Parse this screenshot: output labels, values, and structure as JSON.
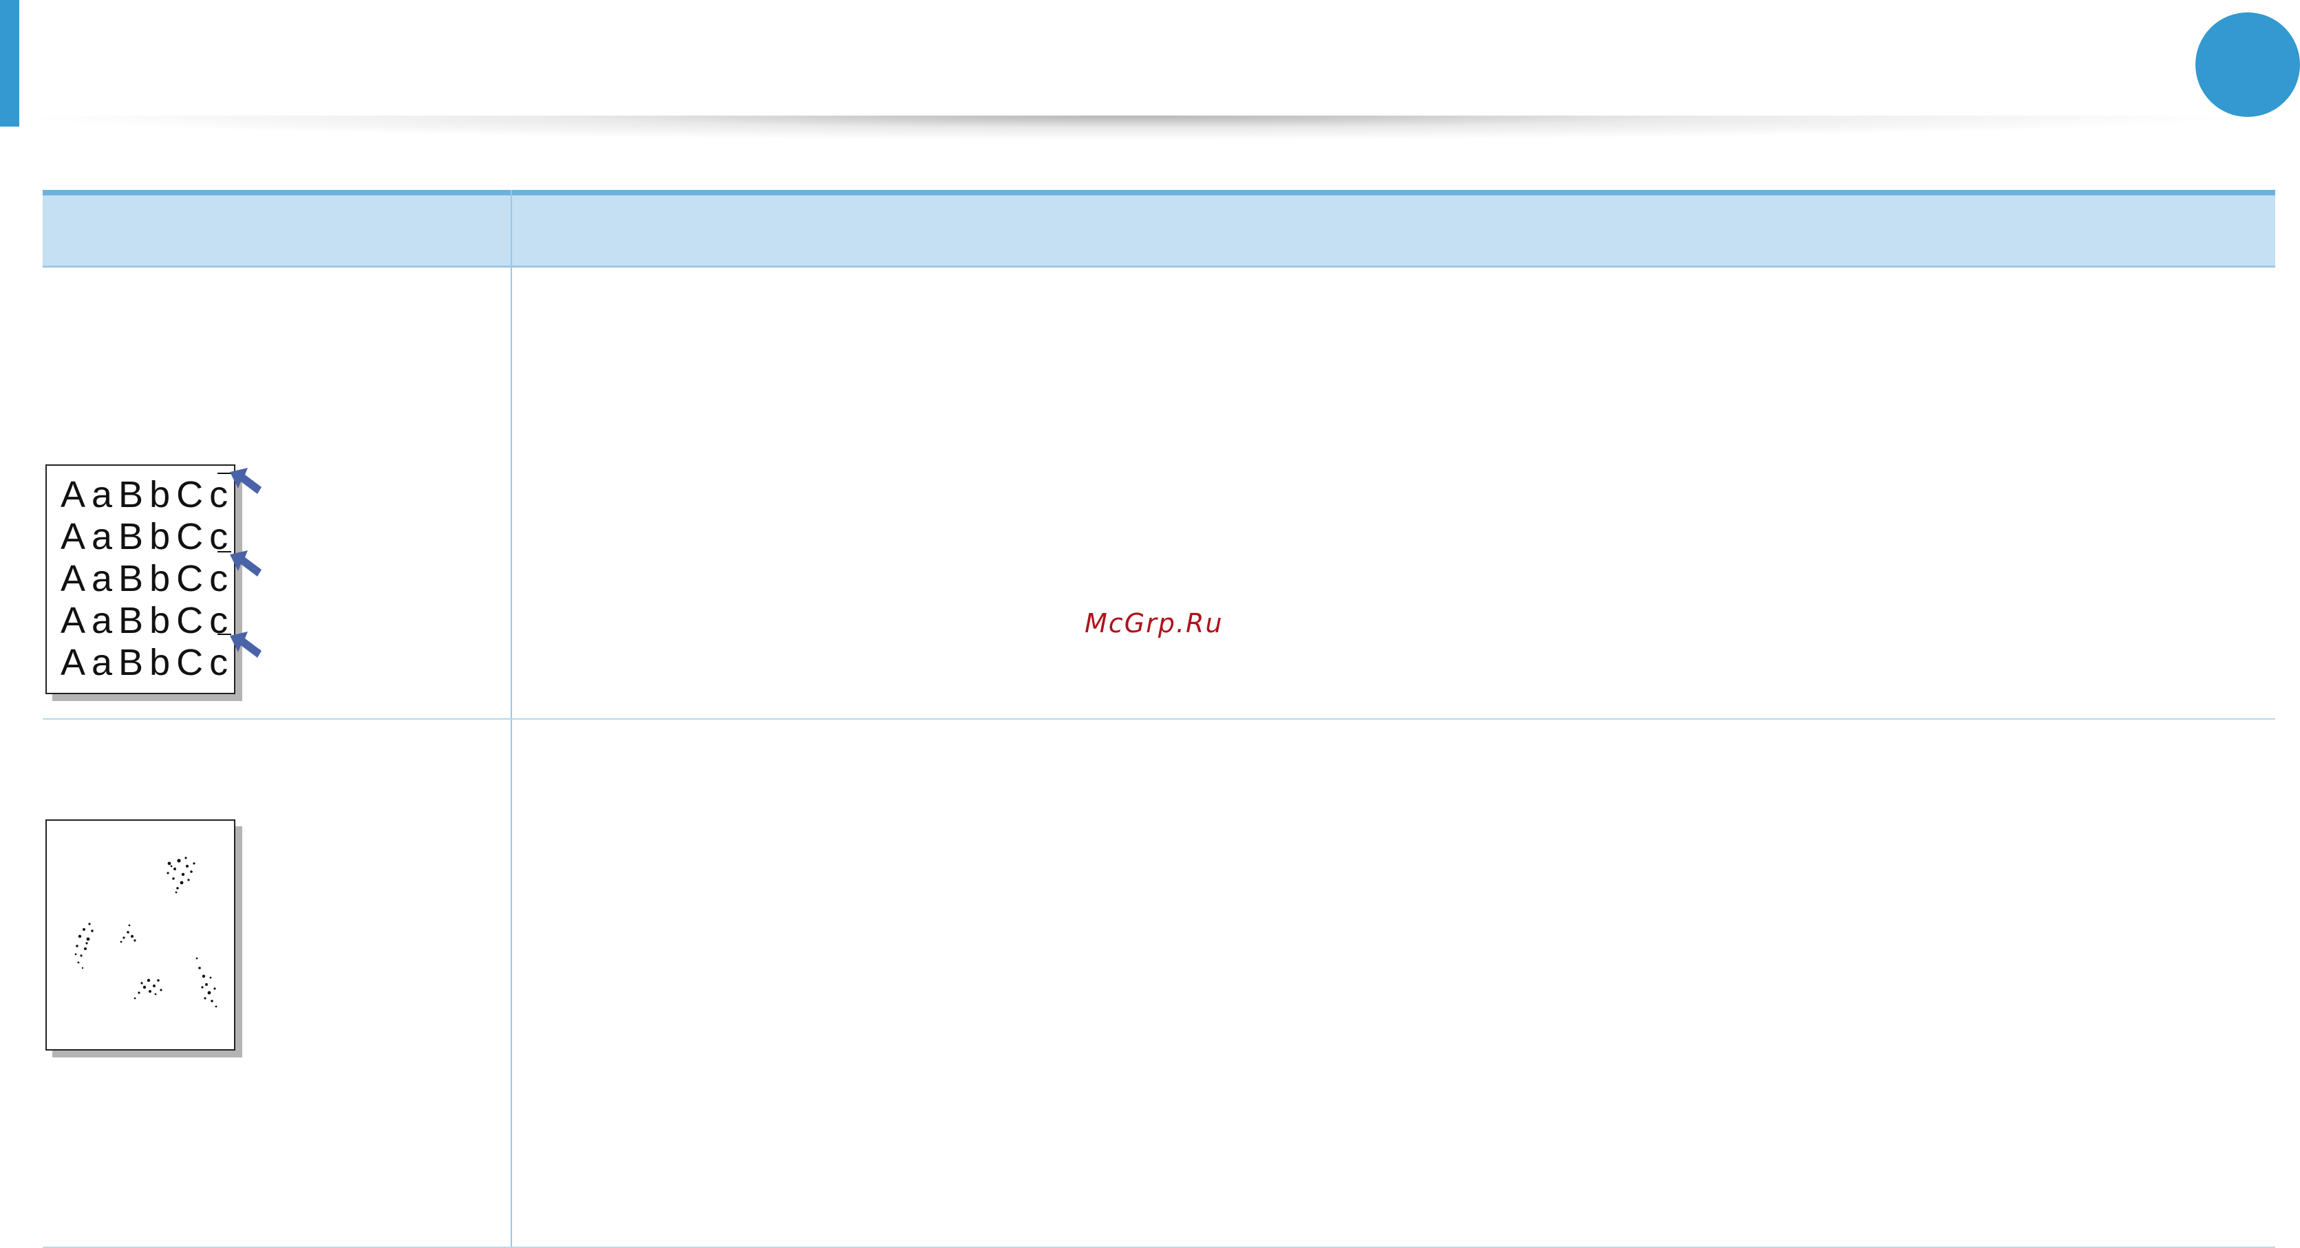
{
  "colors": {
    "accent": "#3399d0",
    "table_header_fill": "#c5e0f2",
    "table_rule": "#6db2df",
    "arrow": "#4a63a8",
    "watermark": "#b0121b"
  },
  "watermark": {
    "text": "McGrp.Ru"
  },
  "table": {
    "rows": [
      {
        "sample": {
          "icon": "repeating-defects-sample-icon",
          "lines": [
            "AaBbCc",
            "AaBbCc",
            "AaBbCc",
            "AaBbCc",
            "AaBbCc"
          ]
        }
      },
      {
        "sample": {
          "icon": "background-scatter-sample-icon"
        }
      }
    ]
  }
}
